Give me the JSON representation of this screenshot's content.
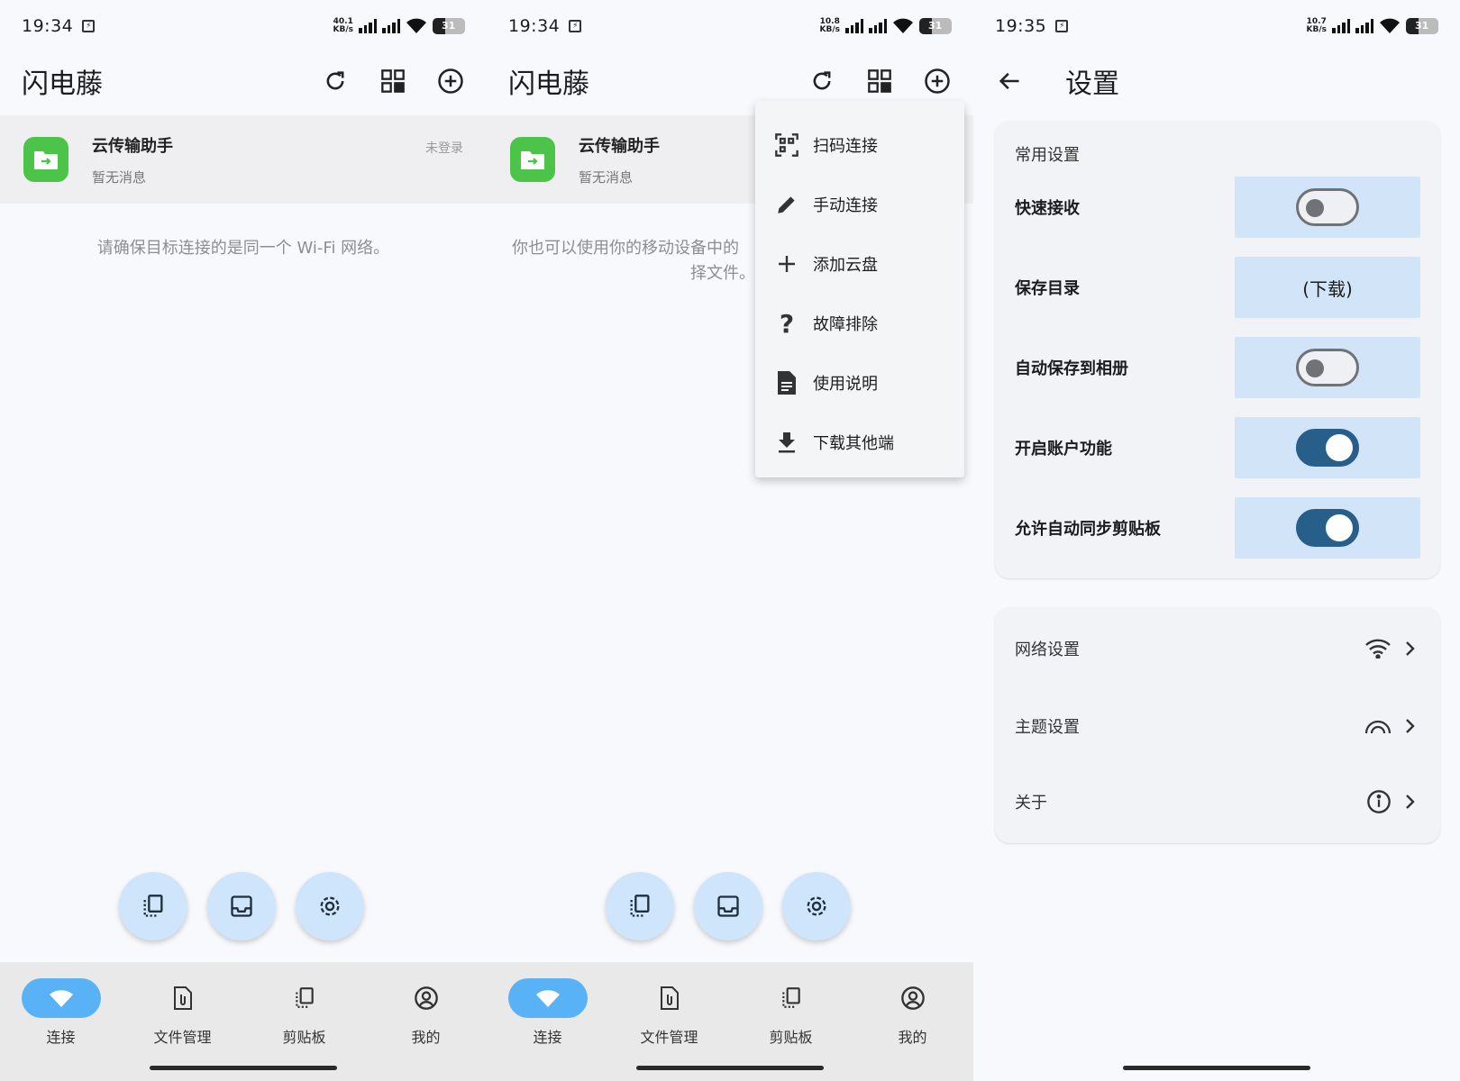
{
  "panels": [
    {
      "status": {
        "time": "19:34",
        "speed_top": "40.1",
        "speed_unit": "KB/s",
        "battery": "31"
      },
      "app_title": "闪电藤",
      "device": {
        "name": "云传输助手",
        "message": "暂无消息",
        "badge": "未登录"
      },
      "hint": "请确保目标连接的是同一个 Wi-Fi 网络。",
      "nav": [
        "连接",
        "文件管理",
        "剪贴板",
        "我的"
      ]
    },
    {
      "status": {
        "time": "19:34",
        "speed_top": "10.8",
        "speed_unit": "KB/s",
        "battery": "31"
      },
      "app_title": "闪电藤",
      "device": {
        "name": "云传输助手",
        "message": "暂无消息"
      },
      "hint_line1": "你也可以使用你的移动设备中的",
      "hint_line2": "择文件。",
      "menu": [
        "扫码连接",
        "手动连接",
        "添加云盘",
        "故障排除",
        "使用说明",
        "下载其他端"
      ],
      "nav": [
        "连接",
        "文件管理",
        "剪贴板",
        "我的"
      ]
    },
    {
      "status": {
        "time": "19:35",
        "speed_top": "10.7",
        "speed_unit": "KB/s",
        "battery": "31"
      },
      "title": "设置",
      "common_title": "常用设置",
      "rows": [
        {
          "label": "快速接收",
          "type": "toggle",
          "on": false
        },
        {
          "label": "保存目录",
          "type": "value",
          "value": "(下载)"
        },
        {
          "label": "自动保存到相册",
          "type": "toggle",
          "on": false
        },
        {
          "label": "开启账户功能",
          "type": "toggle",
          "on": true
        },
        {
          "label": "允许自动同步剪贴板",
          "type": "toggle",
          "on": true
        }
      ],
      "links": [
        {
          "label": "网络设置",
          "icon": "wifi-icon"
        },
        {
          "label": "主题设置",
          "icon": "rainbow-icon"
        },
        {
          "label": "关于",
          "icon": "info-icon"
        }
      ]
    }
  ],
  "colors": {
    "accent": "#5ab2f6",
    "fab": "#cfe5fb",
    "toggle_on": "#275f8a",
    "control_bg": "#d2e4f7",
    "app_green": "#4cc449"
  }
}
